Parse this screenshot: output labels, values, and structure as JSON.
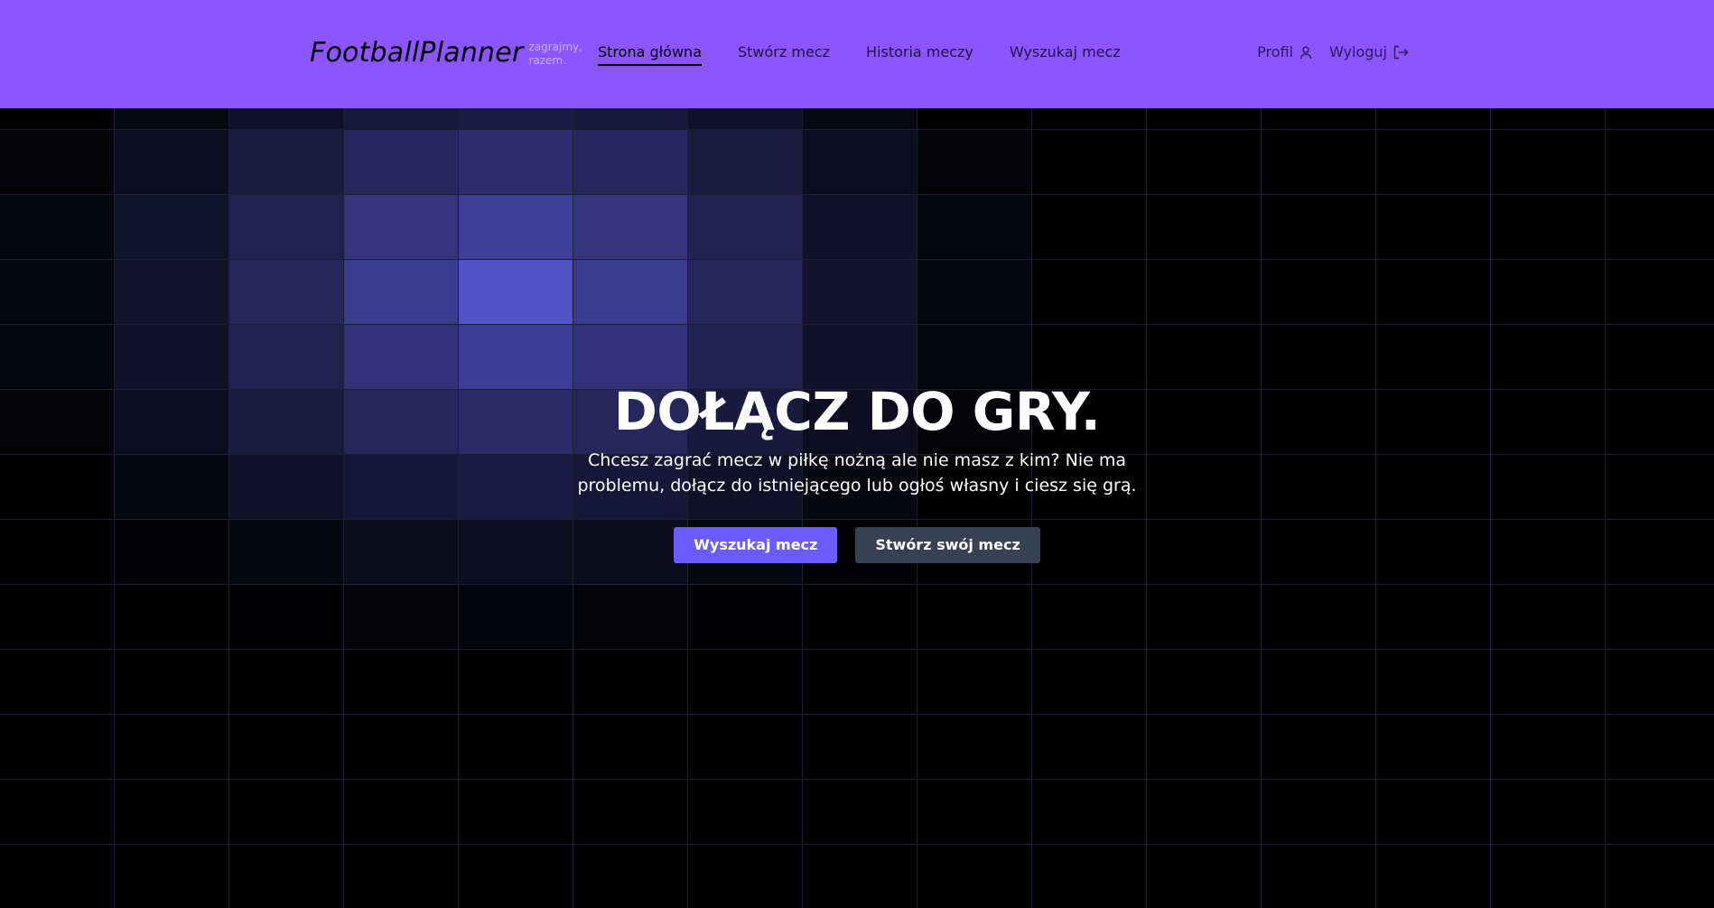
{
  "header": {
    "brand": "FootballPlanner",
    "tagline": "zagrajmy, razem.",
    "nav": [
      {
        "label": "Strona główna",
        "active": true
      },
      {
        "label": "Stwórz mecz",
        "active": false
      },
      {
        "label": "Historia meczy",
        "active": false
      },
      {
        "label": "Wyszukaj mecz",
        "active": false
      }
    ],
    "profile_label": "Profil",
    "logout_label": "Wyloguj",
    "background_color": "#8b55ff"
  },
  "hero": {
    "title": "DOŁĄCZ DO GRY.",
    "description": "Chcesz zagrać mecz w piłkę nożną ale nie masz z kim? Nie ma problemu, dołącz do istniejącego lub ogłoś własny i ciesz się grą.",
    "primary_button": "Wyszukaj mecz",
    "secondary_button": "Stwórz swój mecz",
    "primary_color": "#6a5cff",
    "secondary_color": "#364152"
  },
  "background": {
    "color": "#000000",
    "grid_line_color": "#1a2030",
    "highlight_color": "#5254c8"
  }
}
